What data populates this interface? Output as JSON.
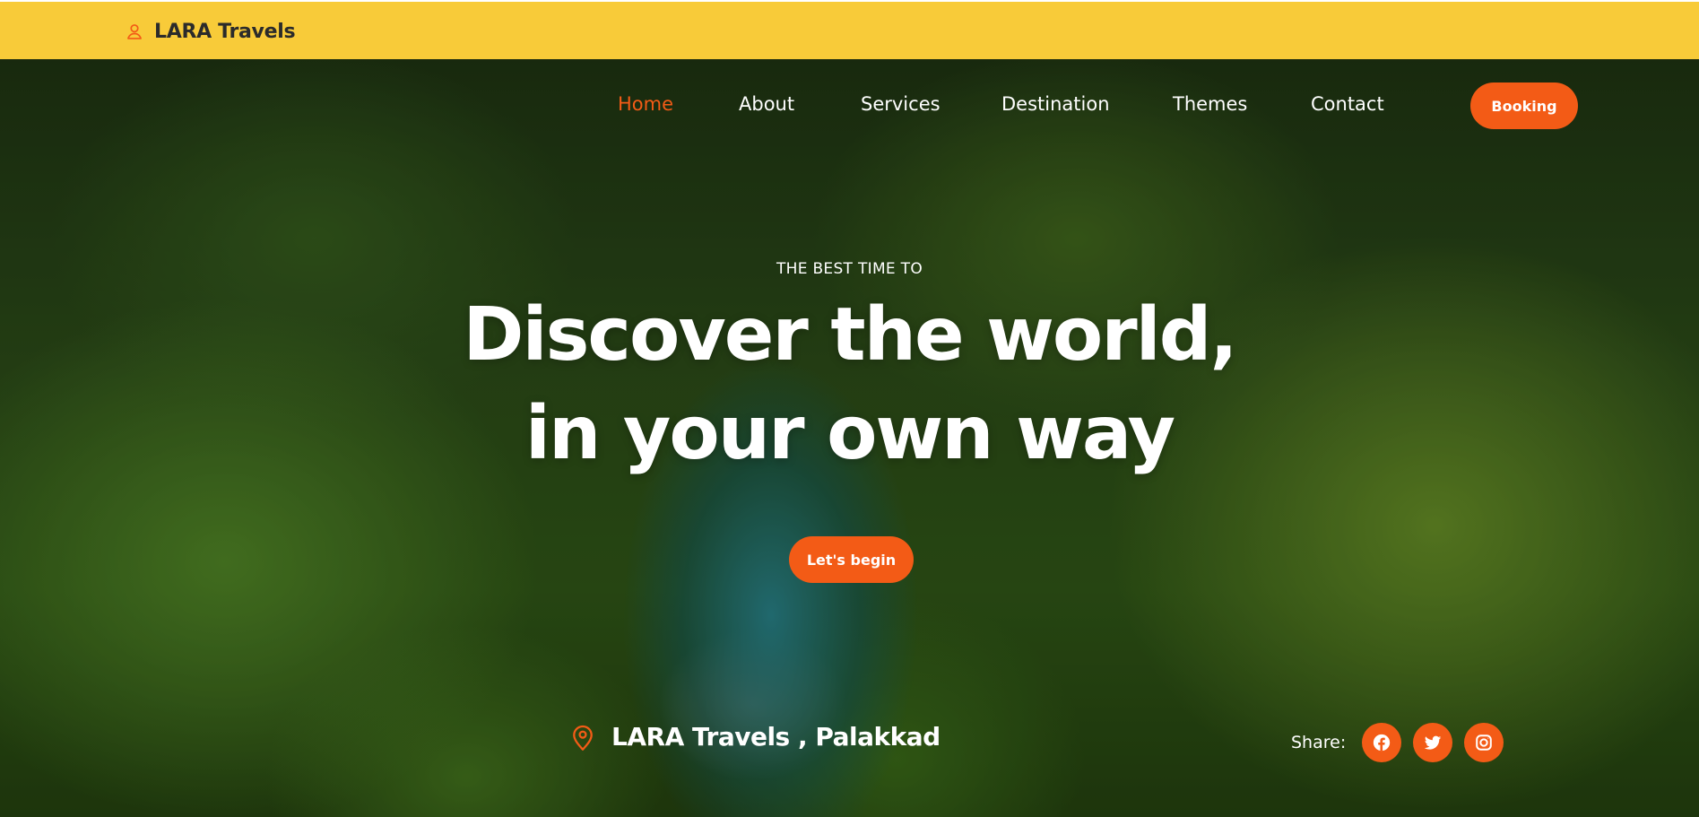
{
  "brand": {
    "name": "LARA Travels",
    "icon": "user-icon"
  },
  "nav": {
    "items": [
      {
        "label": "Home",
        "active": true
      },
      {
        "label": "About",
        "active": false
      },
      {
        "label": "Services",
        "active": false
      },
      {
        "label": "Destination",
        "active": false
      },
      {
        "label": "Themes",
        "active": false
      },
      {
        "label": "Contact",
        "active": false
      }
    ],
    "booking_label": "Booking"
  },
  "hero": {
    "eyebrow": "THE BEST TIME TO",
    "headline_line1": "Discover the world,",
    "headline_line2": "in your own way",
    "cta_label": "Let's begin"
  },
  "location": {
    "text": "LARA Travels , Palakkad",
    "icon": "map-pin-icon"
  },
  "share": {
    "label": "Share:",
    "networks": [
      "facebook-icon",
      "twitter-icon",
      "instagram-icon"
    ]
  },
  "colors": {
    "topbar": "#f8cb39",
    "accent": "#f35b16",
    "text_light": "#ffffff",
    "text_dark": "#2b2b2b"
  }
}
